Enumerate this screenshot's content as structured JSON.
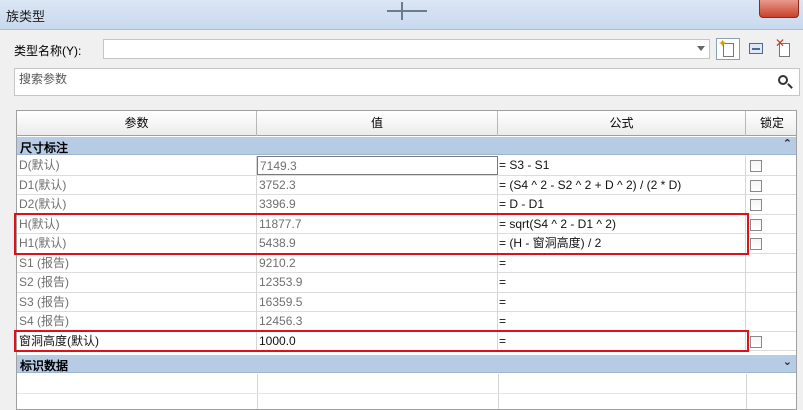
{
  "window": {
    "title": "族类型"
  },
  "type_name": {
    "label": "类型名称(Y):",
    "value": ""
  },
  "search": {
    "placeholder": "搜索参数"
  },
  "columns": {
    "param": "参数",
    "value": "值",
    "formula": "公式",
    "lock": "锁定"
  },
  "groups": [
    {
      "title": "尺寸标注",
      "toggle": "⌃"
    },
    {
      "title": "标识数据",
      "toggle": "⌄"
    }
  ],
  "rows": [
    {
      "param": "D(默认)",
      "value": "7149.3",
      "formula": "= S3 - S1",
      "lock": true
    },
    {
      "param": "D1(默认)",
      "value": "3752.3",
      "formula": "= (S4 ^ 2 - S2 ^ 2 + D ^ 2) / (2 * D)",
      "lock": true
    },
    {
      "param": "D2(默认)",
      "value": "3396.9",
      "formula": "= D - D1",
      "lock": true
    },
    {
      "param": "H(默认)",
      "value": "11877.7",
      "formula": "= sqrt(S4 ^ 2 - D1 ^ 2)",
      "lock": true
    },
    {
      "param": "H1(默认)",
      "value": "5438.9",
      "formula": "= (H - 窗洞高度) / 2",
      "lock": true
    },
    {
      "param": "S1 (报告)",
      "value": "9210.2",
      "formula": "=",
      "lock": false
    },
    {
      "param": "S2 (报告)",
      "value": "12353.9",
      "formula": "=",
      "lock": false
    },
    {
      "param": "S3 (报告)",
      "value": "16359.5",
      "formula": "=",
      "lock": false
    },
    {
      "param": "S4 (报告)",
      "value": "12456.3",
      "formula": "=",
      "lock": false
    },
    {
      "param": "窗洞高度(默认)",
      "value": "1000.0",
      "formula": "=",
      "lock": true
    }
  ],
  "colors": {
    "group_bg": "#b6cce4",
    "highlight": "#e0101a"
  }
}
